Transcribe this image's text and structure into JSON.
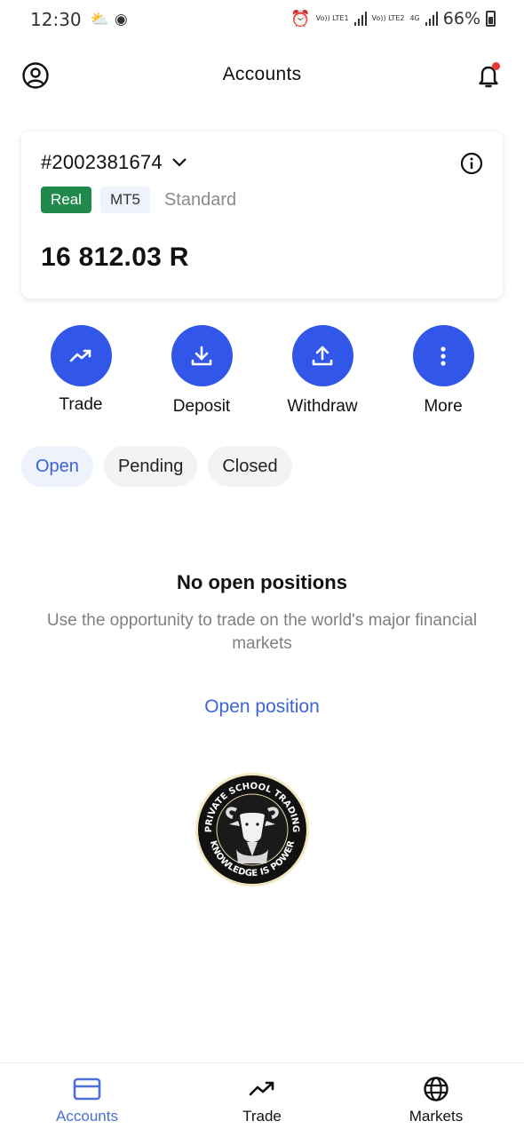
{
  "status_bar": {
    "time": "12:30",
    "sim1": "Vo)) LTE1",
    "sim2": "Vo)) LTE2",
    "network_4g": "4G",
    "battery": "66%"
  },
  "header": {
    "title": "Accounts"
  },
  "account": {
    "number": "#2002381674",
    "badge_real": "Real",
    "badge_platform": "MT5",
    "badge_type": "Standard",
    "balance": "16 812.03 R"
  },
  "actions": [
    {
      "label": "Trade",
      "icon": "trending-up-icon"
    },
    {
      "label": "Deposit",
      "icon": "download-icon"
    },
    {
      "label": "Withdraw",
      "icon": "upload-icon"
    },
    {
      "label": "More",
      "icon": "more-vertical-icon"
    }
  ],
  "tabs": [
    {
      "label": "Open",
      "active": true
    },
    {
      "label": "Pending",
      "active": false
    },
    {
      "label": "Closed",
      "active": false
    }
  ],
  "empty_state": {
    "title": "No open positions",
    "description": "Use the opportunity to trade on the world's major financial markets",
    "cta": "Open position"
  },
  "watermark": {
    "top_text": "PRIVATE SCHOOL TRADING",
    "bottom_text": "KNOWLEDGE IS POWER"
  },
  "bottom_nav": [
    {
      "label": "Accounts",
      "icon": "card-icon",
      "active": true
    },
    {
      "label": "Trade",
      "icon": "trending-up-icon",
      "active": false
    },
    {
      "label": "Markets",
      "icon": "globe-icon",
      "active": false
    }
  ],
  "colors": {
    "accent": "#3257e8",
    "link": "#3d63d8",
    "real_badge": "#1f8a4c",
    "notification_dot": "#e53935"
  }
}
